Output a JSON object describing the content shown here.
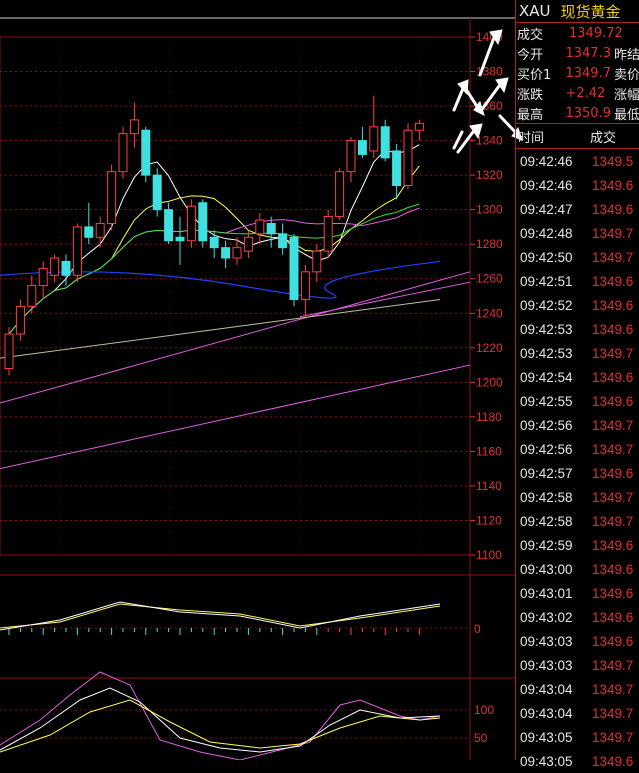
{
  "header": {
    "symbol": "XAU",
    "name": "现货黄金"
  },
  "quote": [
    {
      "k": "成交",
      "v": "1349.72",
      "k2": ""
    },
    {
      "k": "今开",
      "v": "1347.3",
      "k2": "昨结"
    },
    {
      "k": "买价1",
      "v": "1349.7",
      "k2": "卖价"
    },
    {
      "k": "涨跌",
      "v": "+2.42",
      "k2": "涨幅"
    },
    {
      "k": "最高",
      "v": "1350.9",
      "k2": "最低"
    }
  ],
  "ticks_header": {
    "time": "时间",
    "price": "成交"
  },
  "ticks": [
    {
      "t": "09:42:46",
      "p": "1349.5"
    },
    {
      "t": "09:42:46",
      "p": "1349.6"
    },
    {
      "t": "09:42:47",
      "p": "1349.6"
    },
    {
      "t": "09:42:48",
      "p": "1349.7"
    },
    {
      "t": "09:42:50",
      "p": "1349.7"
    },
    {
      "t": "09:42:51",
      "p": "1349.6"
    },
    {
      "t": "09:42:52",
      "p": "1349.6"
    },
    {
      "t": "09:42:53",
      "p": "1349.6"
    },
    {
      "t": "09:42:53",
      "p": "1349.7"
    },
    {
      "t": "09:42:54",
      "p": "1349.6"
    },
    {
      "t": "09:42:55",
      "p": "1349.6"
    },
    {
      "t": "09:42:56",
      "p": "1349.7"
    },
    {
      "t": "09:42:56",
      "p": "1349.7"
    },
    {
      "t": "09:42:57",
      "p": "1349.6"
    },
    {
      "t": "09:42:58",
      "p": "1349.7"
    },
    {
      "t": "09:42:58",
      "p": "1349.7"
    },
    {
      "t": "09:42:59",
      "p": "1349.6"
    },
    {
      "t": "09:43:00",
      "p": "1349.6"
    },
    {
      "t": "09:43:01",
      "p": "1349.6"
    },
    {
      "t": "09:43:02",
      "p": "1349.6"
    },
    {
      "t": "09:43:03",
      "p": "1349.6"
    },
    {
      "t": "09:43:03",
      "p": "1349.7"
    },
    {
      "t": "09:43:04",
      "p": "1349.7"
    },
    {
      "t": "09:43:04",
      "p": "1349.7"
    },
    {
      "t": "09:43:05",
      "p": "1349.7"
    },
    {
      "t": "09:43:05",
      "p": "1349.6"
    }
  ],
  "price_axis": [
    "1380",
    "1360",
    "1340",
    "1320",
    "1300",
    "1280",
    "1260",
    "1240",
    "1220",
    "1200",
    "1180",
    "1160",
    "1140",
    "1120",
    "1100"
  ],
  "price_axis_top": "1400",
  "macd_axis": [
    "0"
  ],
  "kdj_axis": [
    "100",
    "50"
  ],
  "colors": {
    "up": "#ff4040",
    "down": "#40e0e0",
    "grid": "#8a1010",
    "axis": "#e03030"
  },
  "chart_data": {
    "type": "candlestick",
    "candles": [
      {
        "o": 1208,
        "c": 1228,
        "h": 1232,
        "l": 1204
      },
      {
        "o": 1228,
        "c": 1244,
        "h": 1248,
        "l": 1224
      },
      {
        "o": 1244,
        "c": 1256,
        "h": 1262,
        "l": 1240
      },
      {
        "o": 1256,
        "c": 1266,
        "h": 1270,
        "l": 1248
      },
      {
        "o": 1262,
        "c": 1272,
        "h": 1274,
        "l": 1258
      },
      {
        "o": 1270,
        "c": 1262,
        "h": 1274,
        "l": 1256
      },
      {
        "o": 1262,
        "c": 1290,
        "h": 1292,
        "l": 1258
      },
      {
        "o": 1290,
        "c": 1284,
        "h": 1304,
        "l": 1280
      },
      {
        "o": 1284,
        "c": 1292,
        "h": 1296,
        "l": 1278
      },
      {
        "o": 1292,
        "c": 1322,
        "h": 1326,
        "l": 1288
      },
      {
        "o": 1322,
        "c": 1344,
        "h": 1348,
        "l": 1318
      },
      {
        "o": 1344,
        "c": 1352,
        "h": 1362,
        "l": 1336
      },
      {
        "o": 1346,
        "c": 1320,
        "h": 1348,
        "l": 1316
      },
      {
        "o": 1320,
        "c": 1300,
        "h": 1324,
        "l": 1296
      },
      {
        "o": 1300,
        "c": 1282,
        "h": 1304,
        "l": 1280
      },
      {
        "o": 1284,
        "c": 1282,
        "h": 1296,
        "l": 1268
      },
      {
        "o": 1282,
        "c": 1302,
        "h": 1306,
        "l": 1278
      },
      {
        "o": 1304,
        "c": 1282,
        "h": 1306,
        "l": 1278
      },
      {
        "o": 1284,
        "c": 1278,
        "h": 1288,
        "l": 1272
      },
      {
        "o": 1278,
        "c": 1272,
        "h": 1282,
        "l": 1266
      },
      {
        "o": 1272,
        "c": 1278,
        "h": 1284,
        "l": 1268
      },
      {
        "o": 1276,
        "c": 1284,
        "h": 1288,
        "l": 1272
      },
      {
        "o": 1286,
        "c": 1294,
        "h": 1298,
        "l": 1280
      },
      {
        "o": 1292,
        "c": 1286,
        "h": 1296,
        "l": 1278
      },
      {
        "o": 1286,
        "c": 1278,
        "h": 1292,
        "l": 1274
      },
      {
        "o": 1284,
        "c": 1248,
        "h": 1286,
        "l": 1244
      },
      {
        "o": 1248,
        "c": 1264,
        "h": 1268,
        "l": 1238
      },
      {
        "o": 1264,
        "c": 1276,
        "h": 1280,
        "l": 1258
      },
      {
        "o": 1276,
        "c": 1296,
        "h": 1300,
        "l": 1272
      },
      {
        "o": 1296,
        "c": 1322,
        "h": 1324,
        "l": 1294
      },
      {
        "o": 1322,
        "c": 1340,
        "h": 1342,
        "l": 1316
      },
      {
        "o": 1340,
        "c": 1332,
        "h": 1348,
        "l": 1330
      },
      {
        "o": 1334,
        "c": 1348,
        "h": 1366,
        "l": 1330
      },
      {
        "o": 1348,
        "c": 1330,
        "h": 1352,
        "l": 1328
      },
      {
        "o": 1334,
        "c": 1314,
        "h": 1338,
        "l": 1306
      },
      {
        "o": 1314,
        "c": 1346,
        "h": 1350,
        "l": 1312
      },
      {
        "o": 1346,
        "c": 1350,
        "h": 1352,
        "l": 1340
      }
    ],
    "ylim": [
      1100,
      1400
    ]
  }
}
